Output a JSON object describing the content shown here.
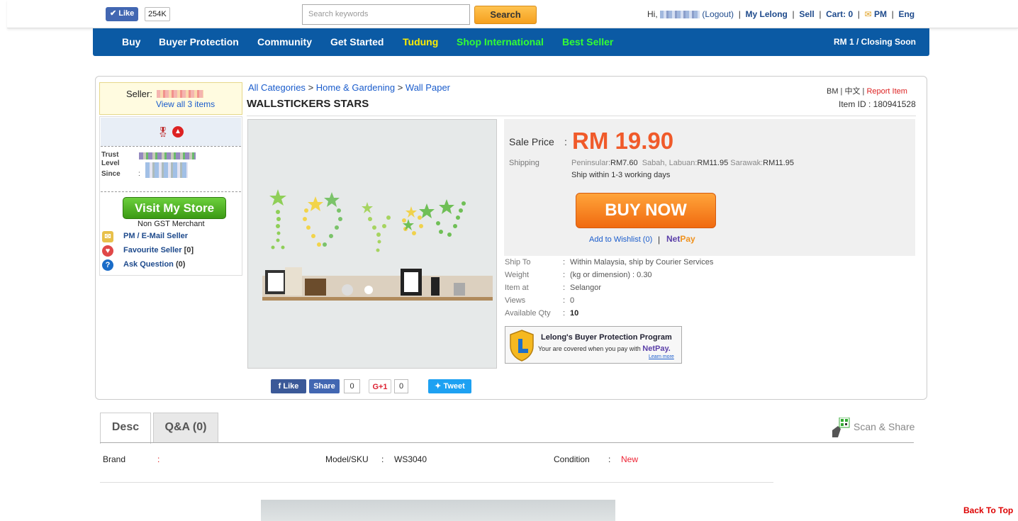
{
  "topbar": {
    "like_label": "Like",
    "like_count": "254K",
    "search_placeholder": "Search keywords",
    "search_button": "Search",
    "greeting": "Hi,",
    "logout": "(Logout)",
    "my_lelong": "My Lelong",
    "sell": "Sell",
    "cart": "Cart: 0",
    "pm": "PM",
    "eng": "Eng"
  },
  "nav": {
    "items": [
      {
        "label": "Buy",
        "color": "#ffffff"
      },
      {
        "label": "Buyer Protection",
        "color": "#ffffff"
      },
      {
        "label": "Community",
        "color": "#ffffff"
      },
      {
        "label": "Get Started",
        "color": "#ffffff"
      },
      {
        "label": "Tudung",
        "color": "#ffee00"
      },
      {
        "label": "Shop International",
        "color": "#33ff33"
      },
      {
        "label": "Best Seller",
        "color": "#33ff33"
      }
    ],
    "right_text": "RM 1  /  Closing Soon"
  },
  "seller": {
    "label": "Seller:",
    "view_all": "View all 3 items",
    "trust_label": "Trust",
    "level_label": "Level",
    "since_label": "Since",
    "since_sep": ":",
    "visit_store": "Visit My Store",
    "gst": "Non GST Merchant",
    "pm_email": "PM / E-Mail Seller",
    "favourite": "Favourite Seller",
    "favourite_count": "[0]",
    "ask_question": "Ask Question",
    "ask_count": "(0)"
  },
  "breadcrumb": {
    "items": [
      "All Categories",
      "Home & Gardening",
      "Wall Paper"
    ],
    "separator": ">"
  },
  "product": {
    "title": "WALLSTICKERS STARS",
    "lang_bm": "BM",
    "lang_cn": "中文",
    "report": "Report Item",
    "item_id": "Item ID : 180941528"
  },
  "price": {
    "sale_label": "Sale Price",
    "sale_value": "RM 19.90",
    "shipping_label": "Shipping",
    "peninsular_label": "Peninsular:",
    "peninsular_value": "RM7.60",
    "sabah_label": "Sabah, Labuan:",
    "sabah_value": "RM11.95",
    "sarawak_label": "Sarawak:",
    "sarawak_value": "RM11.95",
    "ship_within": "Ship within 1-3 working days",
    "buy_now": "BUY NOW",
    "wishlist": "Add to Wishlist (0)",
    "netpay_net": "Net",
    "netpay_pay": "Pay"
  },
  "details": [
    {
      "label": "Ship To",
      "value": "Within Malaysia, ship by Courier Services"
    },
    {
      "label": "Weight",
      "value": "(kg or dimension) : 0.30"
    },
    {
      "label": "Item at",
      "value": "Selangor"
    },
    {
      "label": "Views",
      "value": "0"
    },
    {
      "label": "Available Qty",
      "value": "10"
    }
  ],
  "protection": {
    "title": "Lelong's Buyer Protection Program",
    "text": "Your are covered when you pay with",
    "netpay": "NetPay.",
    "learn": "Learn more"
  },
  "share": {
    "fb_like": "Like",
    "fb_share": "Share",
    "fb_count": "0",
    "gplus": "G+1",
    "gplus_count": "0",
    "tweet": "Tweet"
  },
  "tabs": [
    {
      "label": "Desc"
    },
    {
      "label": "Q&A (0)"
    }
  ],
  "scan_share": "Scan & Share",
  "info_row": {
    "brand_label": "Brand",
    "brand_sep": ":",
    "model_label": "Model/SKU",
    "model_sep": ":",
    "model_value": "WS3040",
    "condition_label": "Condition",
    "condition_sep": ":",
    "condition_value": "New"
  },
  "back_to_top": "Back To Top"
}
